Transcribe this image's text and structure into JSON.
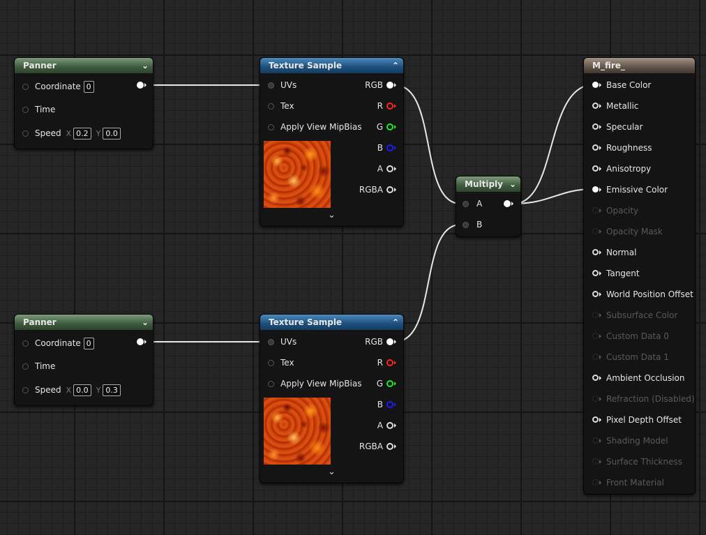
{
  "panner1": {
    "title": "Panner",
    "coordinate_label": "Coordinate",
    "coordinate_value": "0",
    "time_label": "Time",
    "speed_label": "Speed",
    "x_label": "X",
    "x_value": "0.2",
    "y_label": "Y",
    "y_value": "0.0"
  },
  "panner2": {
    "title": "Panner",
    "coordinate_label": "Coordinate",
    "coordinate_value": "0",
    "time_label": "Time",
    "speed_label": "Speed",
    "x_label": "X",
    "x_value": "0.0",
    "y_label": "Y",
    "y_value": "0.3"
  },
  "texture1": {
    "title": "Texture Sample",
    "inputs": [
      "UVs",
      "Tex",
      "Apply View MipBias"
    ],
    "outputs": [
      "RGB",
      "R",
      "G",
      "B",
      "A",
      "RGBA"
    ]
  },
  "texture2": {
    "title": "Texture Sample",
    "inputs": [
      "UVs",
      "Tex",
      "Apply View MipBias"
    ],
    "outputs": [
      "RGB",
      "R",
      "G",
      "B",
      "A",
      "RGBA"
    ]
  },
  "multiply": {
    "title": "Multiply",
    "inputs": [
      "A",
      "B"
    ]
  },
  "material": {
    "title": "M_fire_",
    "pins": [
      {
        "label": "Base Color",
        "enabled": true,
        "connected": true
      },
      {
        "label": "Metallic",
        "enabled": true,
        "connected": false
      },
      {
        "label": "Specular",
        "enabled": true,
        "connected": false
      },
      {
        "label": "Roughness",
        "enabled": true,
        "connected": false
      },
      {
        "label": "Anisotropy",
        "enabled": true,
        "connected": false
      },
      {
        "label": "Emissive Color",
        "enabled": true,
        "connected": true
      },
      {
        "label": "Opacity",
        "enabled": false,
        "connected": false
      },
      {
        "label": "Opacity Mask",
        "enabled": false,
        "connected": false
      },
      {
        "label": "Normal",
        "enabled": true,
        "connected": false
      },
      {
        "label": "Tangent",
        "enabled": true,
        "connected": false
      },
      {
        "label": "World Position Offset",
        "enabled": true,
        "connected": false
      },
      {
        "label": "Subsurface Color",
        "enabled": false,
        "connected": false
      },
      {
        "label": "Custom Data 0",
        "enabled": false,
        "connected": false
      },
      {
        "label": "Custom Data 1",
        "enabled": false,
        "connected": false
      },
      {
        "label": "Ambient Occlusion",
        "enabled": true,
        "connected": false
      },
      {
        "label": "Refraction (Disabled)",
        "enabled": false,
        "connected": false
      },
      {
        "label": "Pixel Depth Offset",
        "enabled": true,
        "connected": false
      },
      {
        "label": "Shading Model",
        "enabled": false,
        "connected": false
      },
      {
        "label": "Surface Thickness",
        "enabled": false,
        "connected": false
      },
      {
        "label": "Front Material",
        "enabled": false,
        "connected": false
      }
    ]
  },
  "colors": {
    "wire": "#e8e8e8",
    "grid_major": "#141414",
    "grid_minor": "#1e1e1e",
    "background": "#262626",
    "red_pin": "#ff2424",
    "green_pin": "#22e822",
    "blue_pin": "#1c1cff"
  }
}
